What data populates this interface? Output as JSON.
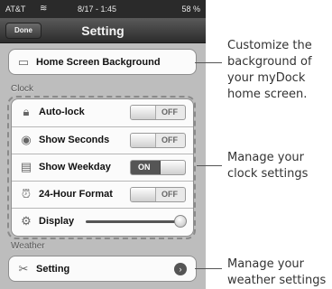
{
  "status_bar": {
    "carrier": "AT&T",
    "time": "8/17 - 1:45",
    "battery": "58 %"
  },
  "nav": {
    "done_label": "Done",
    "title": "Setting"
  },
  "home_bg_row": {
    "label": "Home Screen Background",
    "icon": "wallpaper-icon"
  },
  "clock": {
    "section_label": "Clock",
    "rows": [
      {
        "label": "Auto-lock",
        "icon": "lock-icon",
        "toggle": "OFF"
      },
      {
        "label": "Show Seconds",
        "icon": "clock-icon",
        "toggle": "OFF"
      },
      {
        "label": "Show Weekday",
        "icon": "calendar-icon",
        "toggle": "ON"
      },
      {
        "label": "24-Hour Format",
        "icon": "alarm-clock-icon",
        "toggle": "OFF"
      }
    ],
    "display": {
      "label": "Display",
      "icon": "gear-icon",
      "level": 1.0
    }
  },
  "weather": {
    "section_label": "Weather",
    "row": {
      "label": "Setting",
      "icon": "tools-icon"
    }
  },
  "annotations": {
    "customize": [
      "Customize the",
      "background of",
      "your myDock",
      "home screen."
    ],
    "clock": [
      "Manage your",
      "clock settings"
    ],
    "weather": [
      "Manage your",
      "weather settings"
    ]
  }
}
